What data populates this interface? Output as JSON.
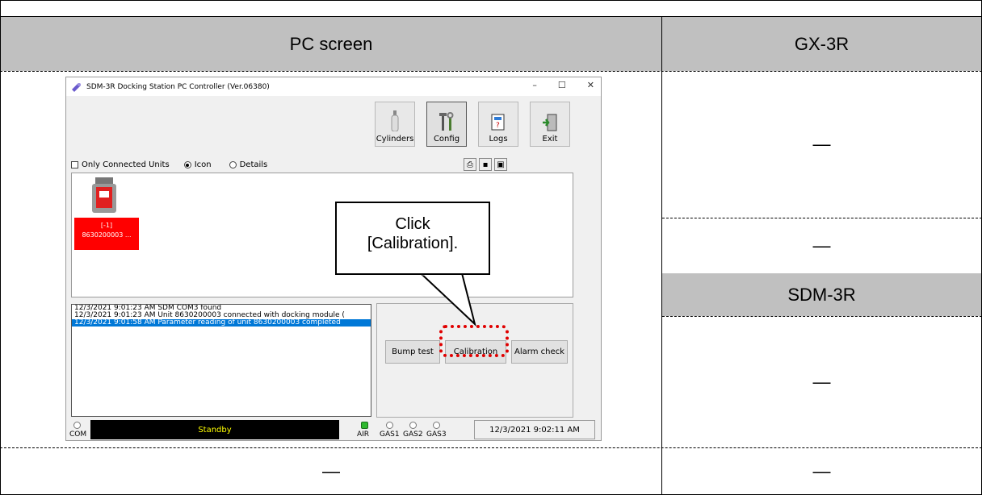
{
  "table": {
    "col1_header": "PC screen",
    "col2_header": "GX-3R",
    "sdm_header": "SDM-3R",
    "dash": "—"
  },
  "app": {
    "title": "SDM-3R Docking Station PC Controller (Ver.06380)",
    "window_controls": [
      "–",
      "☐",
      "✕"
    ],
    "toolbar": [
      {
        "label": "Cylinders",
        "icon": "cylinder-icon"
      },
      {
        "label": "Config",
        "icon": "tools-icon"
      },
      {
        "label": "Logs",
        "icon": "log-book-icon"
      },
      {
        "label": "Exit",
        "icon": "exit-door-icon"
      }
    ],
    "options": {
      "only_connected": "Only Connected Units",
      "icon": "Icon",
      "details": "Details"
    },
    "unit": {
      "line1": "[-1]",
      "line2": "8630200003 ..."
    },
    "log": [
      "12/3/2021 9:01:23 AM SDM COM3 found",
      "12/3/2021 9:01:23 AM Unit 8630200003 connected with docking module (",
      "12/3/2021 9:01:58 AM Parameter reading of unit 8630200003 completed"
    ],
    "buttons": {
      "bump": "Bump test",
      "calibration": "Calibration",
      "alarm": "Alarm check"
    },
    "status": {
      "com": "COM",
      "standby": "Standby",
      "air": "AIR",
      "gas1": "GAS1",
      "gas2": "GAS2",
      "gas3": "GAS3",
      "time": "12/3/2021 9:02:11 AM"
    }
  },
  "callout": {
    "line1": "Click",
    "line2": "[Calibration]."
  },
  "colors": {
    "header_gray": "#c0c0c0",
    "unit_red": "#ff0000",
    "highlight_red": "#e00000",
    "selection_blue": "#0078d7"
  }
}
